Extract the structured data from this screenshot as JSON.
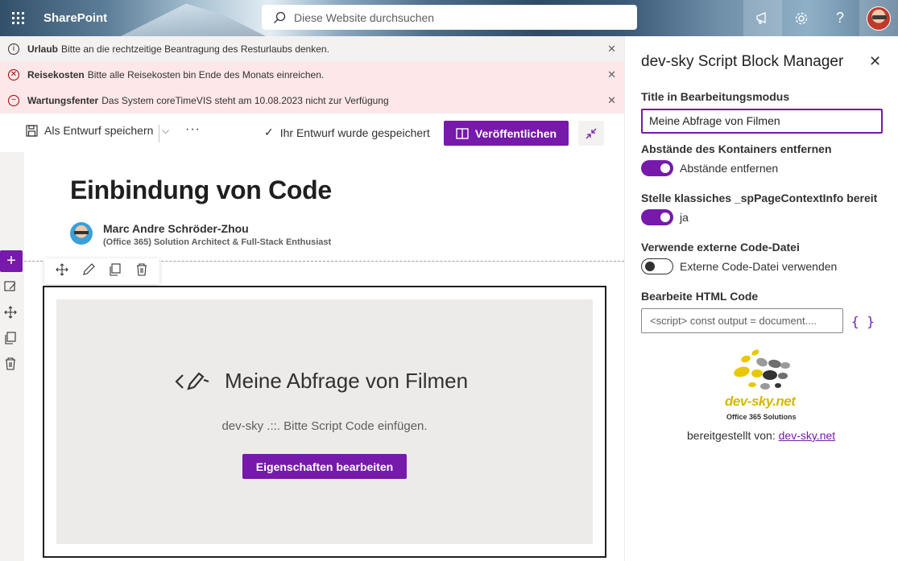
{
  "suite": {
    "brand": "SharePoint",
    "search_placeholder": "Diese Website durchsuchen",
    "icons": [
      "waffle-icon",
      "search-icon",
      "megaphone-icon",
      "gear-icon",
      "help-icon",
      "avatar"
    ]
  },
  "notifications": [
    {
      "title": "Urlaub",
      "text": "Bitte an die rechtzeitige Beantragung des Resturlaubs denken.",
      "icon": "info-icon",
      "color": "#323130"
    },
    {
      "title": "Reisekosten",
      "text": "Bitte alle Reisekosten bin Ende des Monats einreichen.",
      "icon": "error-icon",
      "color": "#a80000"
    },
    {
      "title": "Wartungsfenter",
      "text": "Das System coreTimeVIS steht am 10.08.2023 nicht zur Verfügung",
      "icon": "blocked-icon",
      "color": "#a80000"
    }
  ],
  "commandbar": {
    "save_label": "Als Entwurf speichern",
    "more_label": "···",
    "saved_status": "Ihr Entwurf wurde gespeichert",
    "publish_label": "Veröffentlichen"
  },
  "page": {
    "title": "Einbindung von Code",
    "author_name": "Marc Andre Schröder-Zhou",
    "author_role": "(Office 365) Solution Architect & Full-Stack Enthusiast"
  },
  "webpart": {
    "title": "Meine Abfrage von Filmen",
    "description": "dev-sky .::. Bitte Script Code einfügen.",
    "button_label": "Eigenschaften bearbeiten"
  },
  "pane": {
    "title": "dev-sky Script Block Manager",
    "title_field_label": "Title in Bearbeitungsmodus",
    "title_field_value": "Meine Abfrage von Filmen",
    "spacing_label": "Abstände des Kontainers entfernen",
    "spacing_toggle_text": "Abstände entfernen",
    "spacing_on": true,
    "context_label": "Stelle klassiches _spPageContextInfo bereit",
    "context_toggle_text": "ja",
    "context_on": true,
    "external_label": "Verwende externe Code-Datei",
    "external_toggle_text": "Externe Code-Datei verwenden",
    "external_on": false,
    "html_label": "Bearbeite HTML Code",
    "html_value": "<script> const output = document....",
    "braces": "{ }",
    "logo_text": "dev-sky.net",
    "logo_sub": "Office 365 Solutions",
    "provided_prefix": "bereitgestellt von:",
    "provided_link": "dev-sky.net"
  },
  "colors": {
    "accent": "#7719aa",
    "error_bg": "#fde7e9",
    "info_bg": "#f3f2f1"
  }
}
